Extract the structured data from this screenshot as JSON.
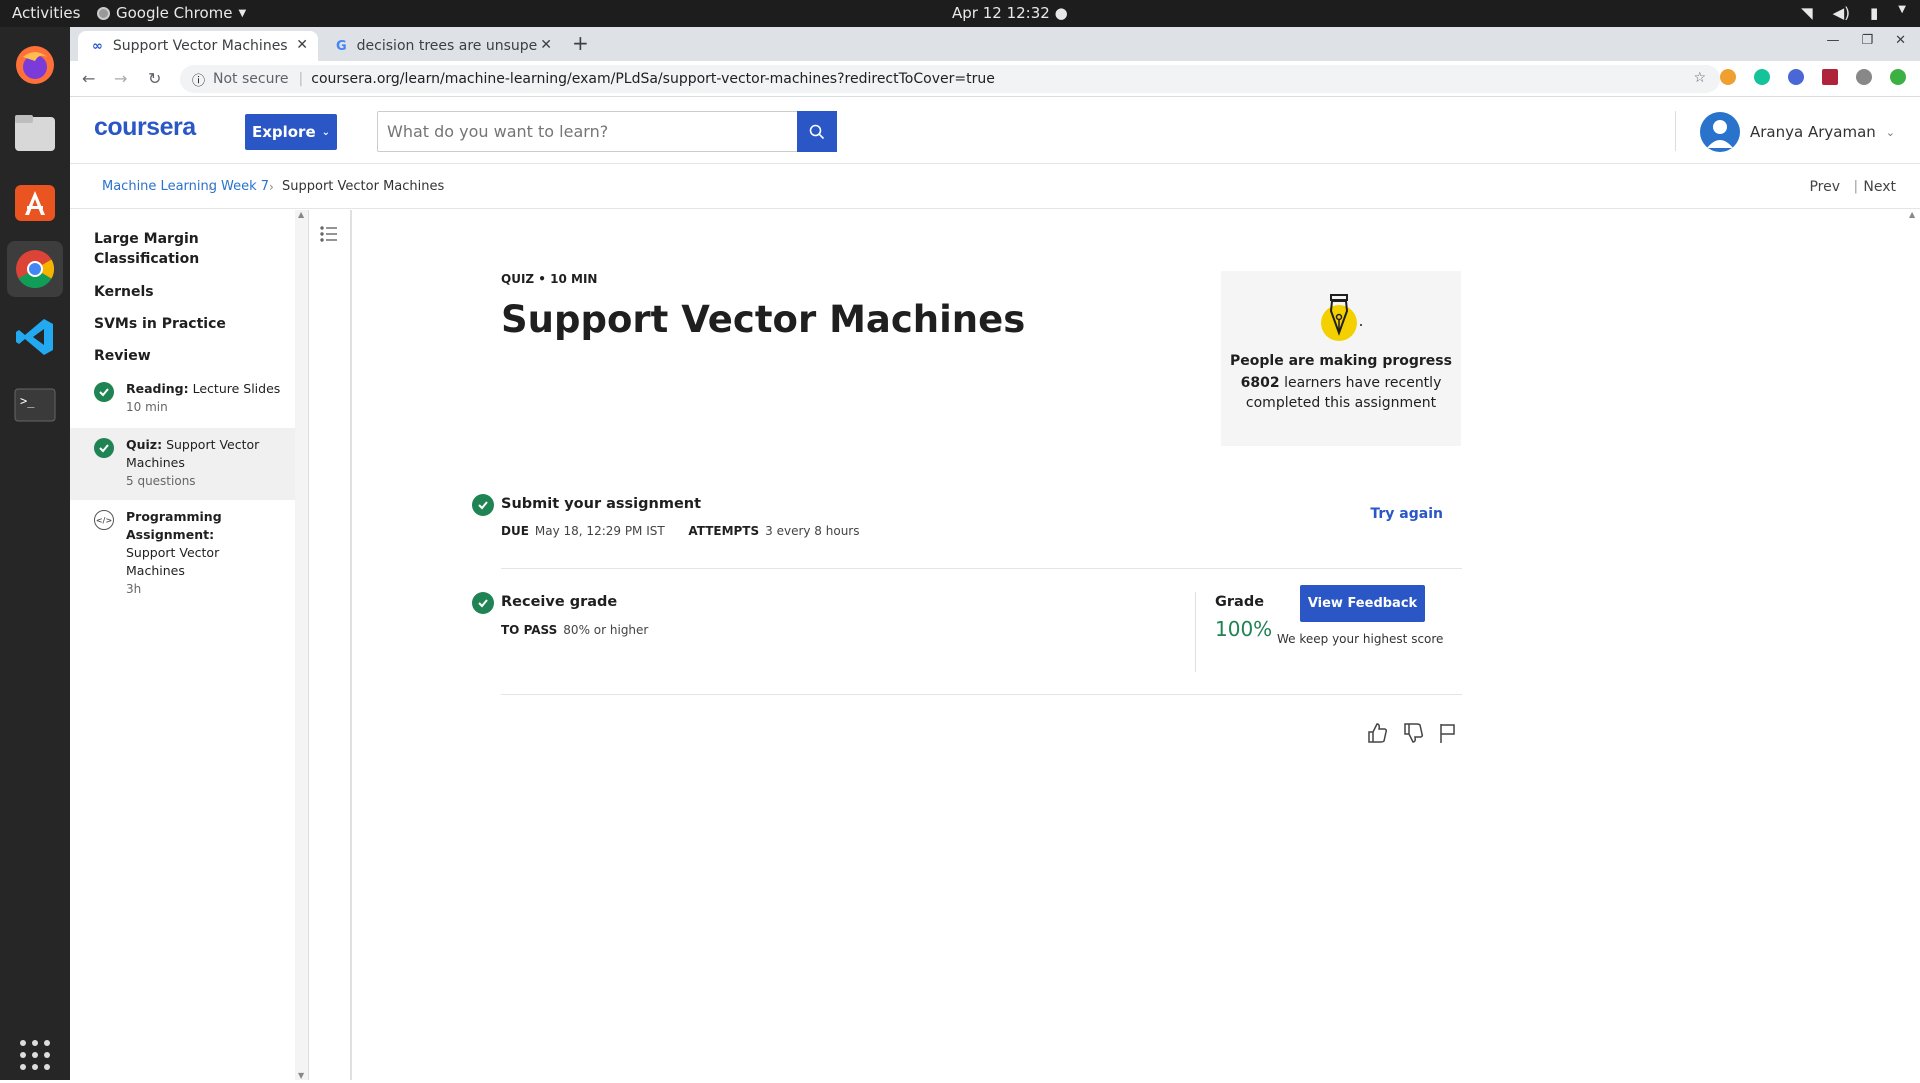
{
  "os": {
    "activities": "Activities",
    "app_name": "Google Chrome",
    "clock": "Apr 12  12:32"
  },
  "browser": {
    "tabs": [
      {
        "label": "Support Vector Machines",
        "close": "✕"
      },
      {
        "label": "decision trees are unsupe",
        "close": "✕"
      }
    ],
    "new_tab": "+",
    "security": "Not secure",
    "url": "coursera.org/learn/machine-learning/exam/PLdSa/support-vector-machines?redirectToCover=true"
  },
  "header": {
    "logo": "coursera",
    "explore": "Explore",
    "search_placeholder": "What do you want to learn?",
    "user_name": "Aranya Aryaman"
  },
  "breadcrumb": {
    "items": [
      "Machine Learning",
      "Week 7",
      "Support Vector Machines"
    ],
    "prev": "Prev",
    "next": "Next"
  },
  "sidebar": {
    "sections": [
      "Large Margin Classification",
      "Kernels",
      "SVMs in Practice",
      "Review"
    ],
    "items": [
      {
        "type": "Reading:",
        "name": "Lecture Slides",
        "sub": "10 min",
        "status": "complete"
      },
      {
        "type": "Quiz:",
        "name": "Support Vector Machines",
        "sub": "5 questions",
        "status": "complete"
      },
      {
        "type": "Programming Assignment:",
        "name": "Support Vector Machines",
        "sub": "3h",
        "status": "code"
      }
    ]
  },
  "quiz": {
    "meta": "QUIZ • 10 MIN",
    "title": "Support Vector Machines",
    "progress_heading": "People are making progress",
    "learners_count": "6802",
    "learners_text": "learners have recently",
    "learners_text2": "completed this assignment",
    "submit_title": "Submit your assignment",
    "due_label": "DUE",
    "due_value": "May 18, 12:29 PM IST",
    "attempts_label": "ATTEMPTS",
    "attempts_value": "3 every 8 hours",
    "try_again": "Try again",
    "receive_title": "Receive grade",
    "topass_label": "TO PASS",
    "topass_value": "80% or higher",
    "grade_label": "Grade",
    "grade_value": "100%",
    "view_feedback": "View Feedback",
    "keep_highest": "We keep your highest score"
  },
  "colors": {
    "brand": "#2a56c6",
    "success": "#1f8354"
  }
}
